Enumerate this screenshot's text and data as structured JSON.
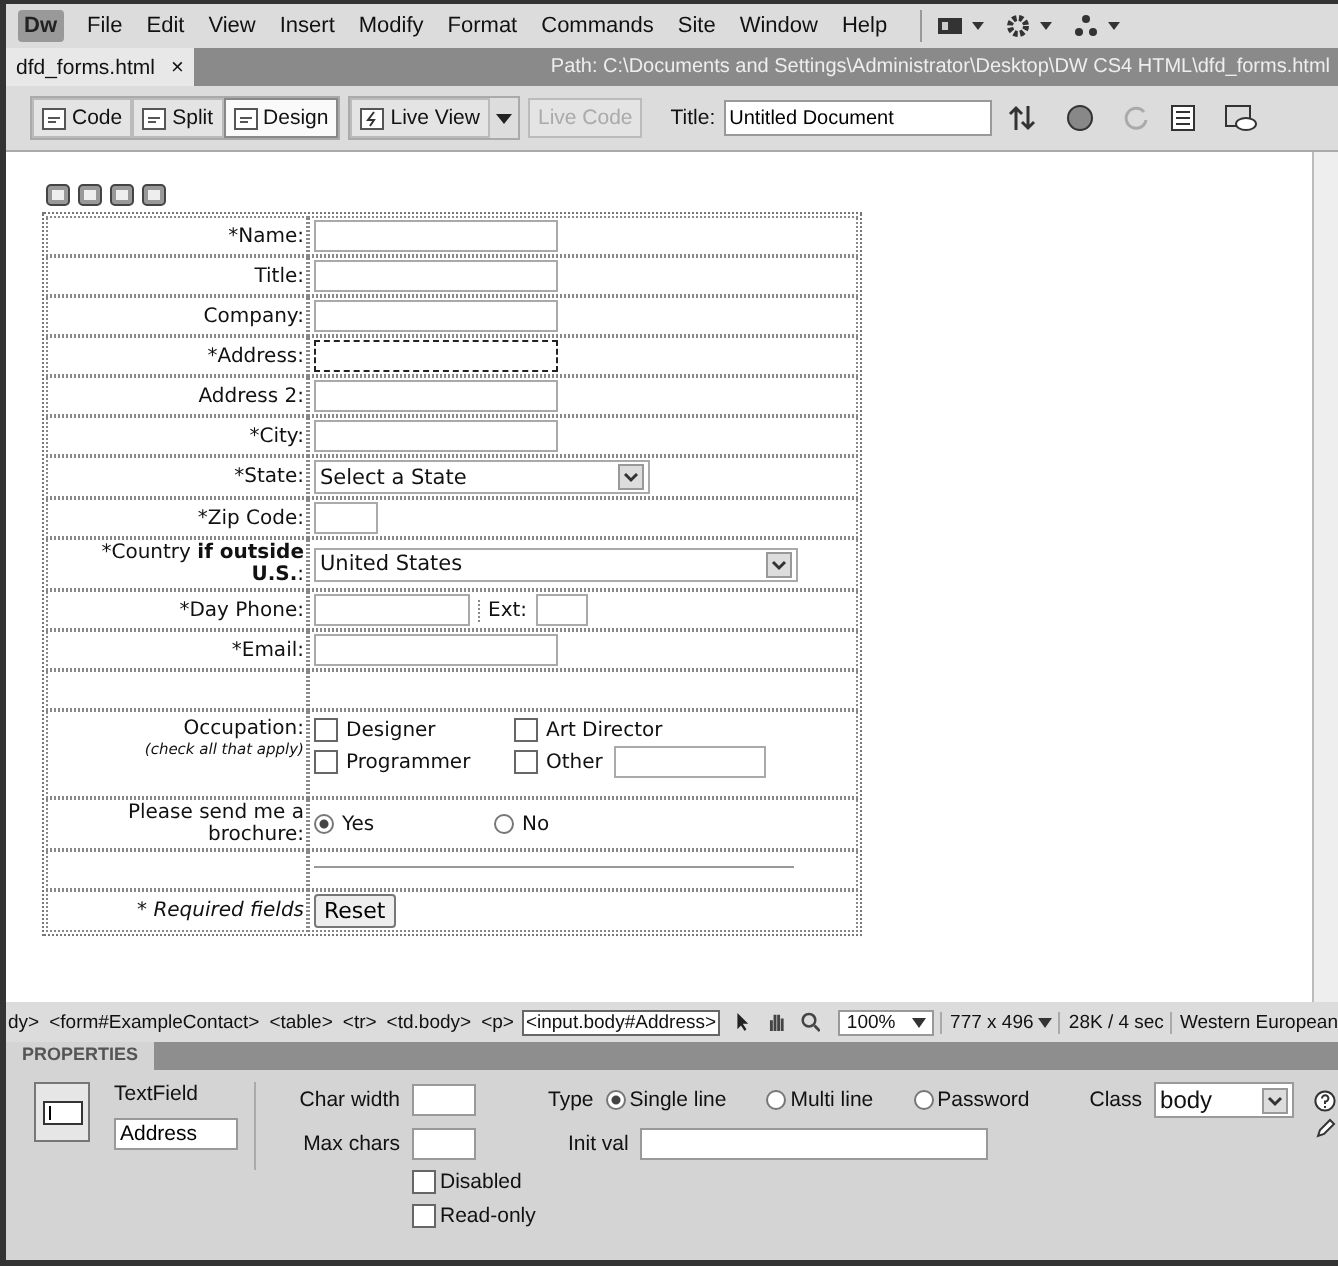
{
  "menubar": {
    "logo": "Dw",
    "items": [
      "File",
      "Edit",
      "View",
      "Insert",
      "Modify",
      "Format",
      "Commands",
      "Site",
      "Window",
      "Help"
    ]
  },
  "document_tab": {
    "label": "dfd_forms.html",
    "close": "×"
  },
  "path": "Path:  C:\\Documents and Settings\\Administrator\\Desktop\\DW CS4 HTML\\dfd_forms.html",
  "toolbar": {
    "views": [
      {
        "label": "Code",
        "selected": false
      },
      {
        "label": "Split",
        "selected": false
      },
      {
        "label": "Design",
        "selected": true
      }
    ],
    "live_view": "Live View",
    "live_code": {
      "label": "Live Code",
      "disabled": true
    },
    "title_label": "Title:",
    "title_value": "Untitled Document"
  },
  "form": {
    "rows": [
      {
        "kind": "text",
        "label": "*Name:",
        "selected": false
      },
      {
        "kind": "text",
        "label": "Title:",
        "selected": false
      },
      {
        "kind": "text",
        "label": "Company:",
        "selected": false
      },
      {
        "kind": "text",
        "label": "*Address:",
        "selected": true
      },
      {
        "kind": "text",
        "label": "Address 2:",
        "selected": false
      },
      {
        "kind": "text",
        "label": "*City:",
        "selected": false
      },
      {
        "kind": "select",
        "label": "*State:",
        "value": "Select a State"
      },
      {
        "kind": "short",
        "label": "*Zip Code:"
      },
      {
        "kind": "wide-select",
        "label": "*Country **if outside U.S.**:",
        "value": "United States"
      },
      {
        "kind": "phone",
        "label": "*Day Phone:",
        "ext_label": "Ext:"
      },
      {
        "kind": "text",
        "label": "*Email:",
        "selected": false
      },
      {
        "kind": "blank"
      },
      {
        "kind": "checkboxes",
        "label": "Occupation:",
        "note": "(check all that apply)",
        "options": [
          {
            "label": "Designer",
            "checked": false,
            "kind": "plain"
          },
          {
            "label": "Art Director",
            "checked": false,
            "kind": "plain"
          },
          {
            "label": "Programmer",
            "checked": false,
            "kind": "plain"
          },
          {
            "label": "Other",
            "checked": false,
            "kind": "with-field"
          }
        ]
      },
      {
        "kind": "radios",
        "label": "Please send me a brochure:",
        "options": [
          {
            "label": "Yes",
            "selected": true
          },
          {
            "label": "No",
            "selected": false
          }
        ]
      },
      {
        "kind": "rule"
      },
      {
        "kind": "button",
        "label": "* Required fields",
        "button": "Reset"
      }
    ]
  },
  "status_bar": {
    "tags": [
      {
        "label": "dy>",
        "selected": false
      },
      {
        "label": "<form#ExampleContact>",
        "selected": false
      },
      {
        "label": "<table>",
        "selected": false
      },
      {
        "label": "<tr>",
        "selected": false
      },
      {
        "label": "<td.body>",
        "selected": false
      },
      {
        "label": "<p>",
        "selected": false
      },
      {
        "label": "<input.body#Address>",
        "selected": true
      }
    ],
    "zoom": "100%",
    "size": "777 x 496",
    "speed": "28K / 4 sec",
    "encoding": "Western European"
  },
  "properties": {
    "header": "PROPERTIES",
    "element_type": "TextField",
    "name": "Address",
    "char_width_label": "Char width",
    "max_chars_label": "Max chars",
    "type_label": "Type",
    "types": [
      {
        "label": "Single line",
        "selected": true
      },
      {
        "label": "Multi line",
        "selected": false
      },
      {
        "label": "Password",
        "selected": false
      }
    ],
    "class_label": "Class",
    "class_value": "body",
    "init_val_label": "Init val",
    "checks": [
      {
        "label": "Disabled",
        "checked": false
      },
      {
        "label": "Read-only",
        "checked": false
      }
    ]
  }
}
